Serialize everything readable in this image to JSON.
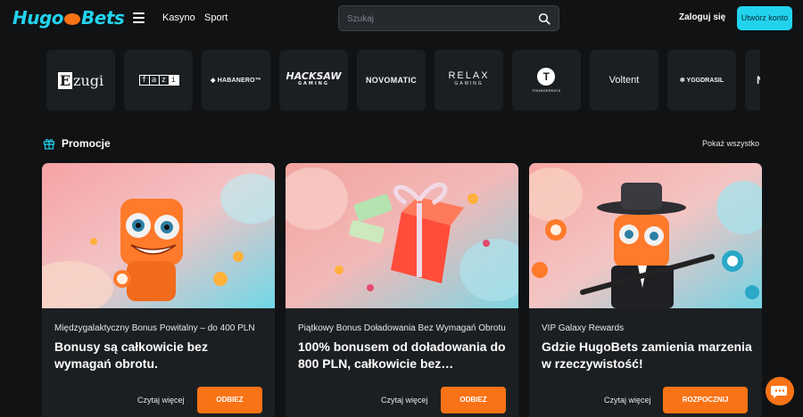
{
  "header": {
    "logo_left": "Hugo",
    "logo_right": "Bets",
    "nav": [
      "Kasyno",
      "Sport"
    ],
    "search_placeholder": "Szukaj",
    "login_label": "Zaloguj się",
    "register_label": "Utwórz konto"
  },
  "providers": {
    "ezugi": "zugi",
    "ezugi_initial": "E",
    "fazi": [
      "f",
      "a",
      "z",
      "i"
    ],
    "habanero": "HABANERO",
    "hacksaw": "HACKSAW",
    "hacksaw_sub": "GAMING",
    "novomatic": "NOVOMATIC",
    "relax": "RELAX",
    "relax_sub": "GAMING",
    "thunderkick": "THUNDERKICK",
    "voltent": "Voltent",
    "yggdrasil": "YGGDRASIL",
    "partial": "N"
  },
  "promotions": {
    "title": "Promocje",
    "show_all": "Pokaż wszystko",
    "cards": [
      {
        "subtitle": "Międzygalaktyczny Bonus Powitalny – do 400 PLN",
        "title": "Bonusy są całkowicie bez wymagań obrotu.",
        "more": "Czytaj więcej",
        "cta": "ODBIEZ TERAZ!"
      },
      {
        "subtitle": "Piątkowy Bonus Doładowania Bez Wymagań Obrotu",
        "title": "100% bonusem od doładowania do 800 PLN, całkowicie bez…",
        "more": "Czytaj więcej",
        "cta": "ODBIEZ TERAZ!"
      },
      {
        "subtitle": "VIP Galaxy Rewards",
        "title": "Gdzie HugoBets zamienia marzenia w rzeczywistość!",
        "more": "Czytaj więcej",
        "cta": "ROZPOCZNIJ TERAZ!"
      }
    ]
  },
  "colors": {
    "accent_cyan": "#22d3ee",
    "accent_orange": "#f97316",
    "background": "#101214",
    "card": "#1c1f22"
  },
  "icons": [
    "menu-icon",
    "search-icon",
    "gift-icon",
    "chat-icon"
  ]
}
